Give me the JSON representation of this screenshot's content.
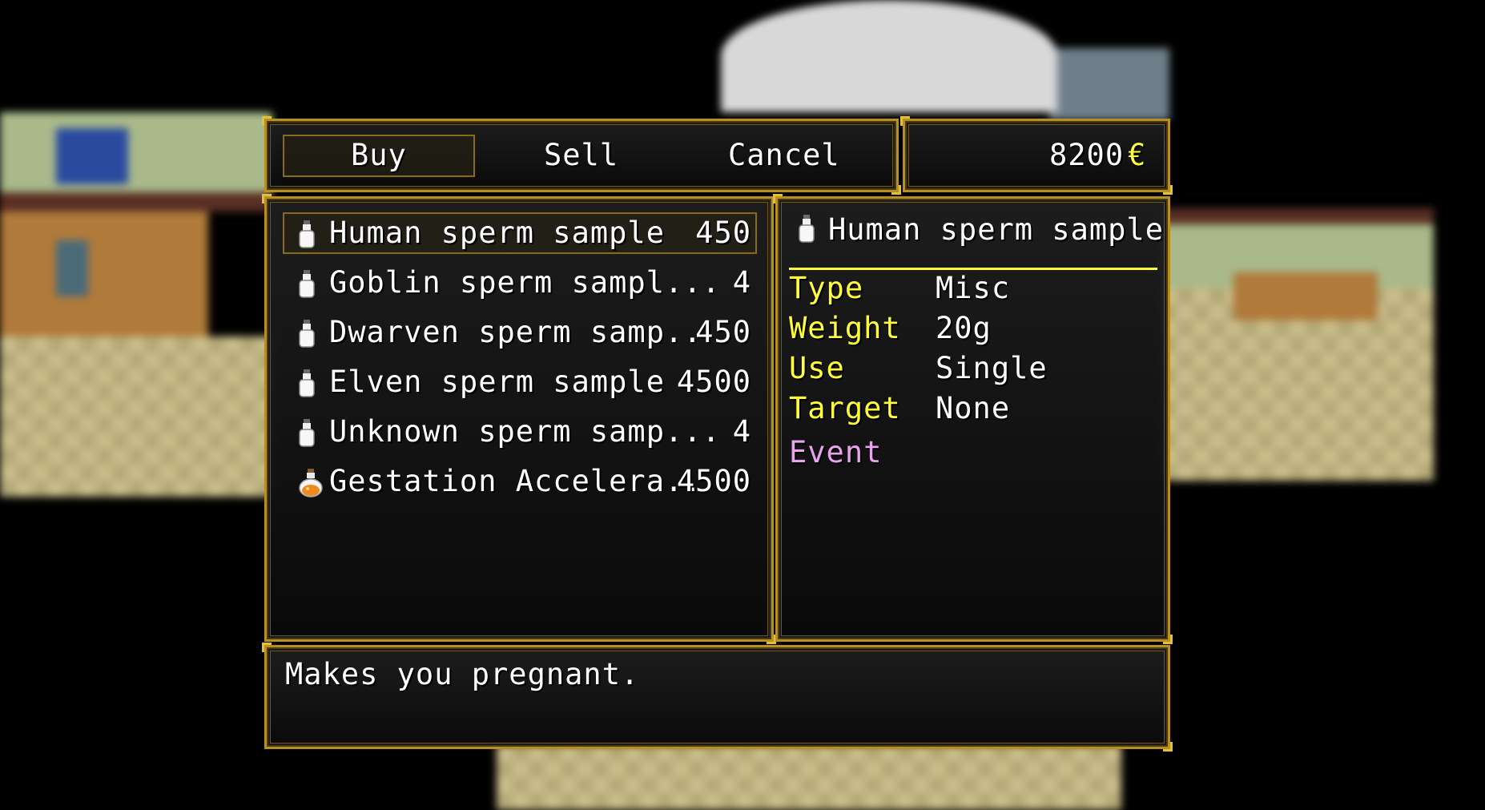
{
  "commands": {
    "buy": "Buy",
    "sell": "Sell",
    "cancel": "Cancel"
  },
  "gold": {
    "amount": "8200",
    "currency": "€"
  },
  "items": [
    {
      "name": "Human sperm sample",
      "price": "450",
      "icon": "white-bottle-icon"
    },
    {
      "name": "Goblin sperm sampl...",
      "price": "4",
      "icon": "white-bottle-icon"
    },
    {
      "name": "Dwarven sperm samp..",
      "price": "450",
      "icon": "white-bottle-icon"
    },
    {
      "name": "Elven sperm sample",
      "price": "4500",
      "icon": "white-bottle-icon"
    },
    {
      "name": "Unknown sperm samp...",
      "price": "4",
      "icon": "white-bottle-icon"
    },
    {
      "name": "Gestation Accelera..",
      "price": "4500",
      "icon": "orange-potion-icon"
    }
  ],
  "detail": {
    "title": "Human sperm sample",
    "rows": [
      {
        "label": "Type",
        "value": "Misc"
      },
      {
        "label": "Weight",
        "value": "20g"
      },
      {
        "label": "Use",
        "value": "Single"
      },
      {
        "label": "Target",
        "value": "None"
      }
    ],
    "event_label": "Event"
  },
  "help": {
    "text": "Makes you pregnant."
  },
  "colors": {
    "frame": "#b88f22",
    "system": "#ffff3a",
    "event": "#e9a3ec"
  }
}
